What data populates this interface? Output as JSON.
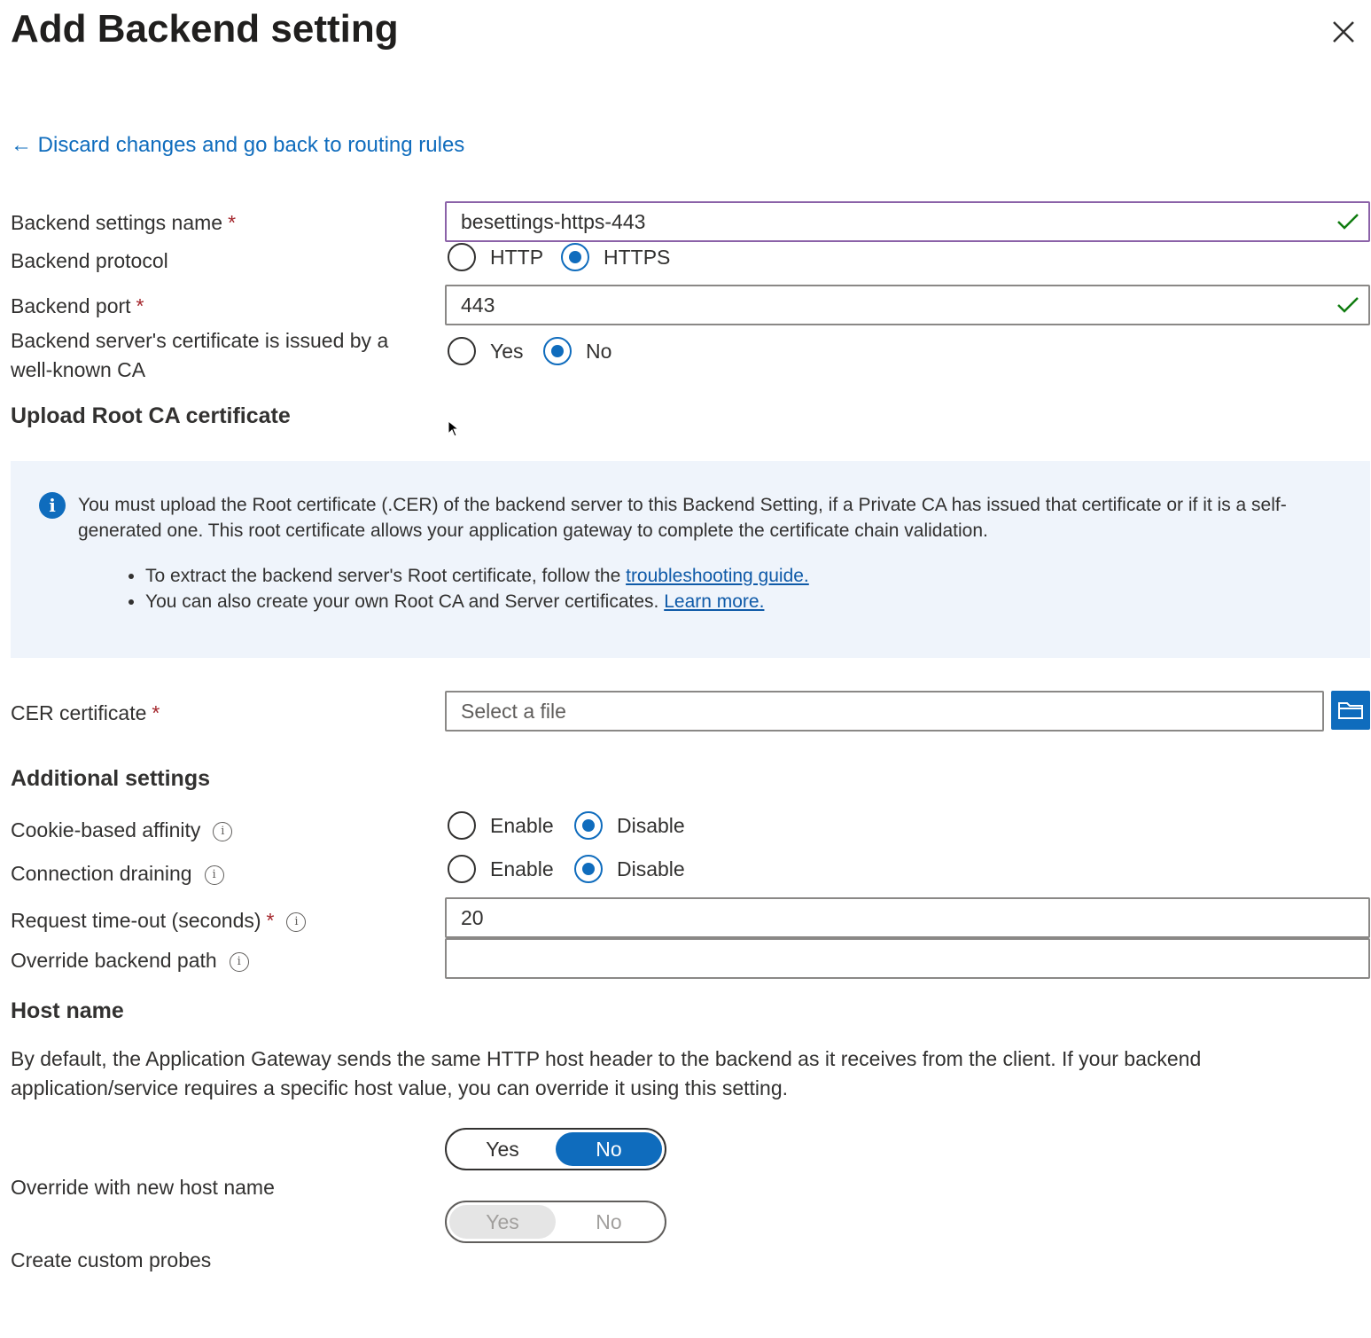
{
  "header": {
    "title": "Add Backend setting",
    "close_icon": "close-icon"
  },
  "back_link": {
    "arrow": "←",
    "label": "Discard changes and go back to routing rules"
  },
  "form": {
    "name": {
      "label": "Backend settings name",
      "required": "*",
      "value": "besettings-https-443"
    },
    "protocol": {
      "label": "Backend protocol",
      "options": [
        "HTTP",
        "HTTPS"
      ],
      "selected": "HTTPS"
    },
    "port": {
      "label": "Backend port",
      "required": "*",
      "value": "443"
    },
    "well_known_ca": {
      "label": "Backend server's certificate is issued by a well-known CA",
      "options": [
        "Yes",
        "No"
      ],
      "selected": "No"
    }
  },
  "upload_section": {
    "title": "Upload Root CA certificate",
    "info": {
      "text": "You must upload the Root certificate (.CER) of the backend server to this Backend Setting, if a Private CA has issued that certificate or if it is a self-generated one. This root certificate allows your application gateway to complete the certificate chain validation.",
      "bullet1_text": "To extract the backend server's Root certificate, follow the",
      "bullet1_link": "troubleshooting guide.",
      "bullet2_text": "You can also create your own Root CA and Server certificates.",
      "bullet2_link": "Learn more."
    },
    "cer": {
      "label": "CER certificate",
      "required": "*",
      "placeholder": "Select a file"
    }
  },
  "additional": {
    "title": "Additional settings",
    "cookie": {
      "label": "Cookie-based affinity",
      "options": [
        "Enable",
        "Disable"
      ],
      "selected": "Disable"
    },
    "draining": {
      "label": "Connection draining",
      "options": [
        "Enable",
        "Disable"
      ],
      "selected": "Disable"
    },
    "timeout": {
      "label": "Request time-out (seconds)",
      "required": "*",
      "value": "20"
    },
    "override_path": {
      "label": "Override backend path",
      "value": ""
    }
  },
  "host": {
    "title": "Host name",
    "description": "By default, the Application Gateway sends the same HTTP host header to the backend as it receives from the client. If your backend application/service requires a specific host value, you can override it using this setting.",
    "override": {
      "label": "Override with new host name",
      "options": [
        "Yes",
        "No"
      ],
      "selected": "No"
    },
    "probes": {
      "label": "Create custom probes",
      "options": [
        "Yes",
        "No"
      ],
      "selected": "Yes",
      "disabled": true
    }
  },
  "info_glyph": "i",
  "colors": {
    "accent": "#0f6cbd",
    "valid": "#107c10",
    "info_bg": "#eff4fb"
  }
}
